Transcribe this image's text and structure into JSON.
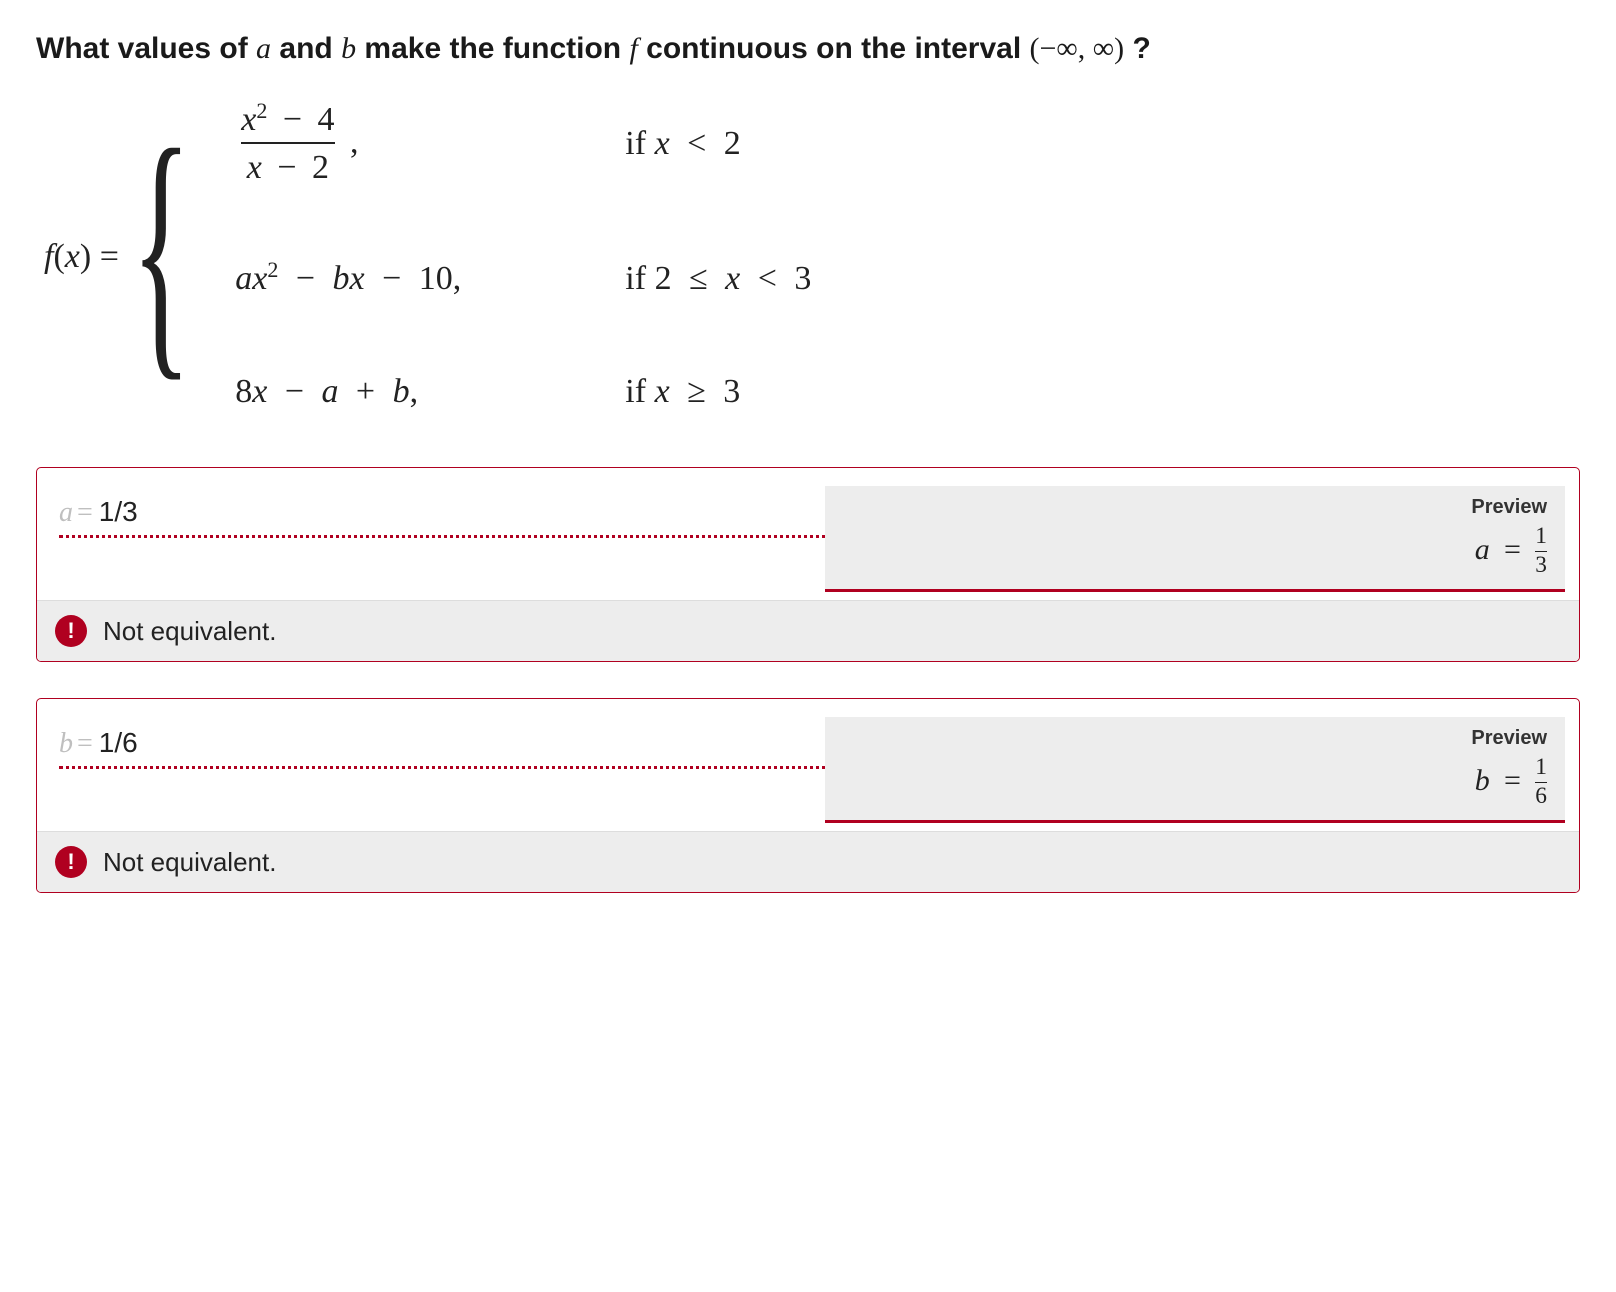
{
  "question": {
    "prefix": "What values of ",
    "var_a": "a",
    "mid1": " and ",
    "var_b": "b",
    "mid2": " make the function ",
    "var_f": "f",
    "mid3": " continuous on the interval ",
    "interval": "(−∞, ∞)",
    "suffix": "?"
  },
  "piecewise": {
    "lhs_f": "f",
    "lhs_x": "x",
    "case1_num_x": "x",
    "case1_num_minus": "−",
    "case1_num_const": "4",
    "case1_den_x": "x",
    "case1_den_minus": "−",
    "case1_den_const": "2",
    "case1_comma": ",",
    "cond1_if": "if ",
    "cond1_x": "x",
    "cond1_op": "<",
    "cond1_val": "2",
    "case2_a": "a",
    "case2_x": "x",
    "case2_minus1": "−",
    "case2_b": "b",
    "case2_x2": "x",
    "case2_minus2": "−",
    "case2_const": "10",
    "case2_comma": ",",
    "cond2_if": "if ",
    "cond2_lo": "2",
    "cond2_le": "≤",
    "cond2_x": "x",
    "cond2_lt": "<",
    "cond2_hi": "3",
    "case3_coef": "8",
    "case3_x": "x",
    "case3_minus": "−",
    "case3_a": "a",
    "case3_plus": "+",
    "case3_b": "b",
    "case3_comma": ",",
    "cond3_if": "if ",
    "cond3_x": "x",
    "cond3_ge": "≥",
    "cond3_val": "3"
  },
  "answers": [
    {
      "var": "a",
      "value": "1/3",
      "preview_label": "Preview",
      "preview_var": "a",
      "preview_num": "1",
      "preview_den": "3",
      "feedback": "Not equivalent."
    },
    {
      "var": "b",
      "value": "1/6",
      "preview_label": "Preview",
      "preview_var": "b",
      "preview_num": "1",
      "preview_den": "6",
      "feedback": "Not equivalent."
    }
  ],
  "colors": {
    "error": "#b00020",
    "muted_bg": "#ededed"
  }
}
